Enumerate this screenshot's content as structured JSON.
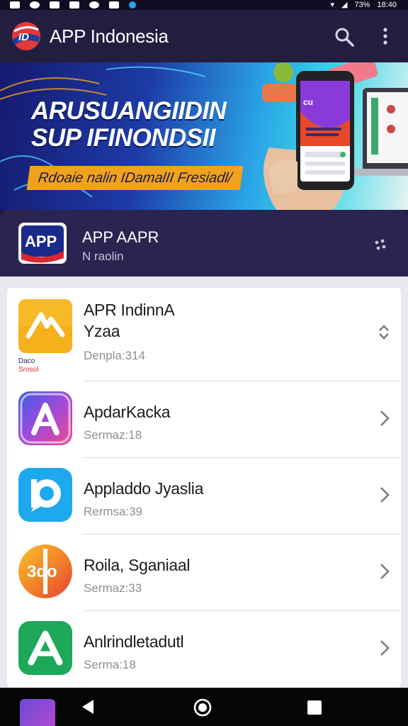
{
  "status_bar": {
    "left_icons": [
      "notification-icon",
      "alarm-icon",
      "gallery-icon",
      "phone-icon",
      "music-icon",
      "mail-icon",
      "check-icon"
    ],
    "battery": "73%",
    "time": "18:40"
  },
  "app_bar": {
    "title": "APP Indonesia",
    "logo_text": "ID",
    "search_icon": "search-icon",
    "more_icon": "more-vert-icon"
  },
  "banner": {
    "headline_line1": "ARUSUANGIIDIN",
    "headline_line2": "SUP IFINONDSII",
    "tagline": "Rdoaie nalin IDamalII Fresiadl/",
    "phone_screen_text": "cu",
    "colors": {
      "accent": "#f0a21e",
      "deep": "#151a6e",
      "light": "#38d8e8"
    }
  },
  "featured": {
    "icon_text": "APP",
    "name": "APP AAPR",
    "subtitle": "N raolin",
    "menu_icon": "dots-icon"
  },
  "apps": [
    {
      "name_line1": "APR IndinnA",
      "name_line2": "Yzaa",
      "meta": "Denpla:314",
      "caption_line1": "Daco",
      "caption_line2": "Srosol",
      "icon": "arrow-icon",
      "chevron": "sort-icon"
    },
    {
      "name_line1": "ApdarKacka",
      "meta": "Sermaz:18",
      "icon": "a-triangle-icon",
      "chevron": "chevron-right-icon"
    },
    {
      "name_line1": "Appladdo Jyaslia",
      "meta": "Rermsa:39",
      "icon": "chat-bubble-icon",
      "chevron": "chevron-right-icon"
    },
    {
      "name_line1": "Roila, Sganiaal",
      "meta": "Sermaz:33",
      "icon": "text-logo-icon",
      "icon_text": "3do",
      "chevron": "chevron-right-icon"
    },
    {
      "name_line1": "Anlrindletadutl",
      "meta": "Serma:18",
      "icon": "a-triangle-icon",
      "chevron": "chevron-right-icon"
    }
  ],
  "nav_bar": {
    "back_icon": "back-icon",
    "home_icon": "home-icon",
    "recent_icon": "recents-icon"
  }
}
